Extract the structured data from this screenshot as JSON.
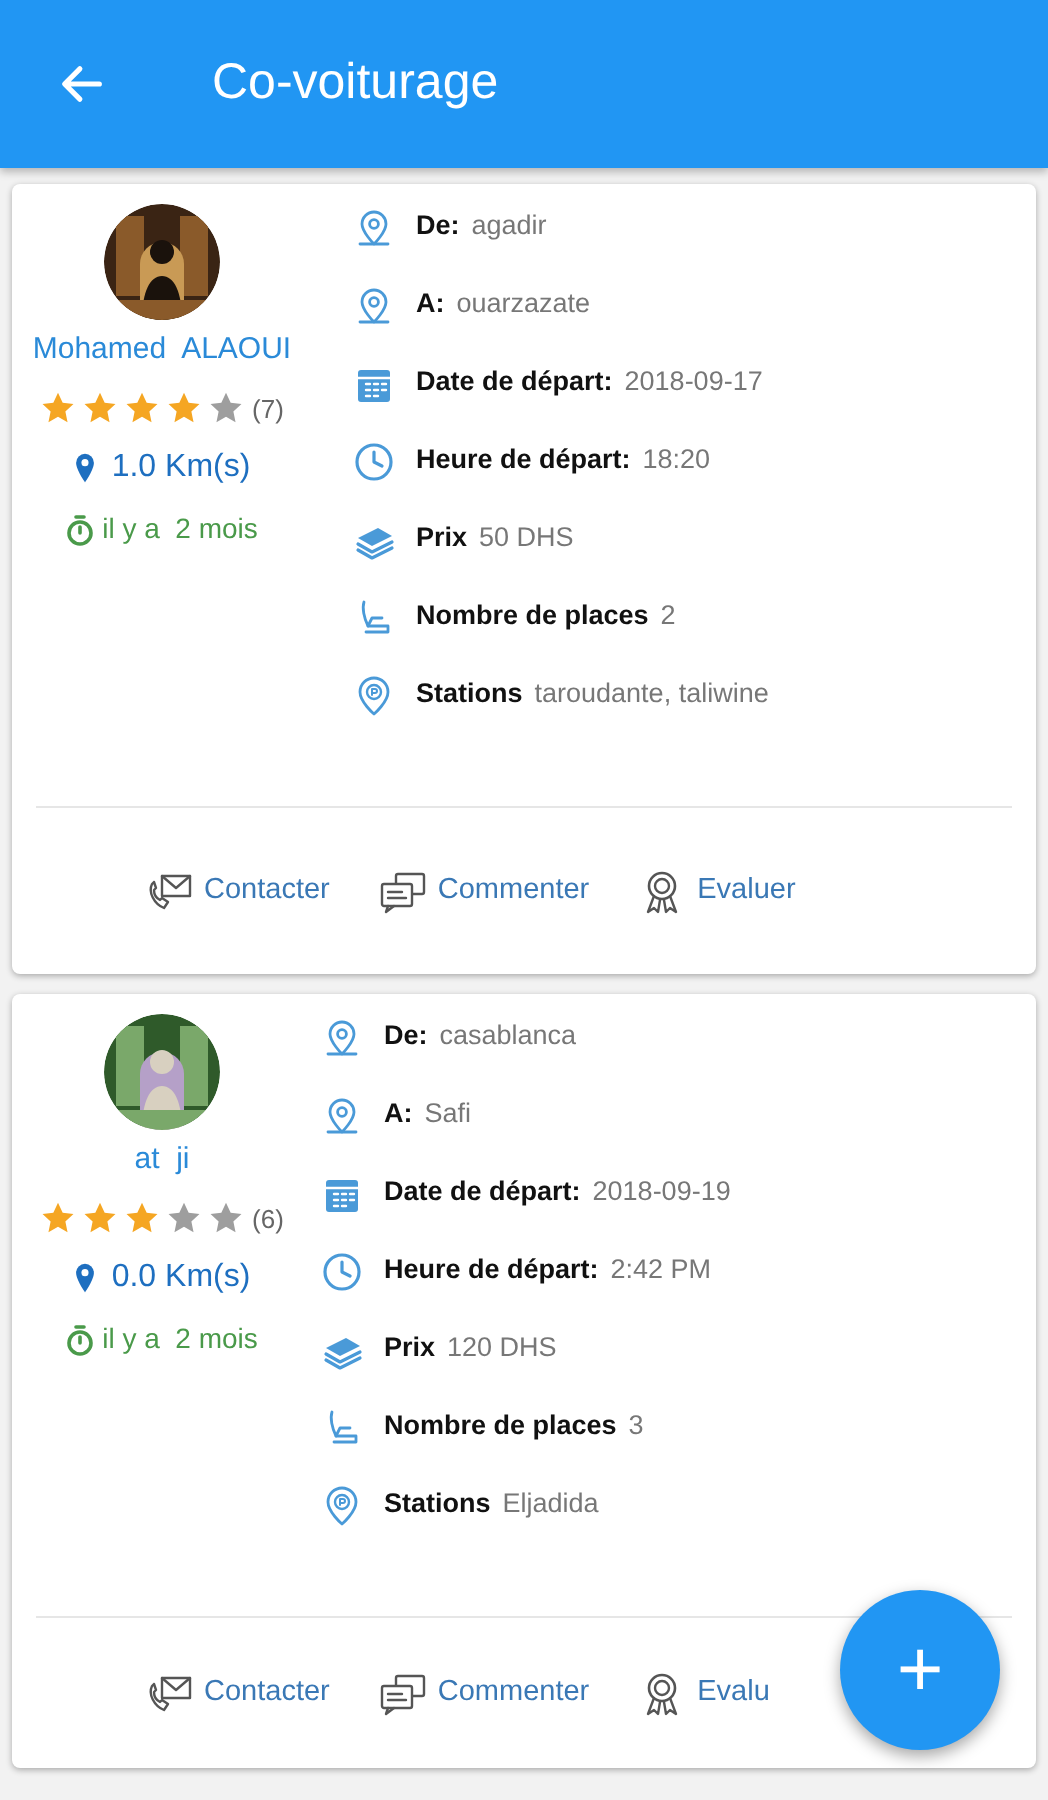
{
  "app_bar": {
    "title": "Co-voiturage"
  },
  "rides": [
    {
      "driver": {
        "name": "Mohamed  ALAOUI",
        "stars": 4,
        "rating_count": "(7)",
        "distance": "1.0 Km(s)",
        "posted": "il y a  2 mois"
      },
      "fields": [
        {
          "kind": "from",
          "label": "De:",
          "value": "agadir"
        },
        {
          "kind": "to",
          "label": "A:",
          "value": "ouarzazate"
        },
        {
          "kind": "date",
          "label": "Date de départ:",
          "value": "2018-09-17"
        },
        {
          "kind": "time",
          "label": "Heure de départ:",
          "value": "18:20"
        },
        {
          "kind": "price",
          "label": "Prix",
          "value": "50 DHS"
        },
        {
          "kind": "seats",
          "label": "Nombre de places",
          "value": "2"
        },
        {
          "kind": "stations",
          "label": "Stations",
          "value": "taroudante, taliwine"
        }
      ],
      "actions": [
        {
          "kind": "contact",
          "label": "Contacter"
        },
        {
          "kind": "comment",
          "label": "Commenter"
        },
        {
          "kind": "rate",
          "label": "Evaluer"
        }
      ]
    },
    {
      "driver": {
        "name": "at  ji",
        "stars": 3,
        "rating_count": "(6)",
        "distance": "0.0 Km(s)",
        "posted": "il y a  2 mois"
      },
      "fields": [
        {
          "kind": "from",
          "label": "De:",
          "value": "casablanca"
        },
        {
          "kind": "to",
          "label": "A:",
          "value": "Safi"
        },
        {
          "kind": "date",
          "label": "Date de départ:",
          "value": "2018-09-19"
        },
        {
          "kind": "time",
          "label": "Heure de départ:",
          "value": "2:42 PM"
        },
        {
          "kind": "price",
          "label": "Prix",
          "value": "120 DHS"
        },
        {
          "kind": "seats",
          "label": "Nombre de places",
          "value": "3"
        },
        {
          "kind": "stations",
          "label": "Stations",
          "value": "Eljadida"
        }
      ],
      "actions": [
        {
          "kind": "contact",
          "label": "Contacter"
        },
        {
          "kind": "comment",
          "label": "Commenter"
        },
        {
          "kind": "rate",
          "label": "Evalu"
        }
      ]
    }
  ],
  "fab": {
    "label": "+"
  }
}
